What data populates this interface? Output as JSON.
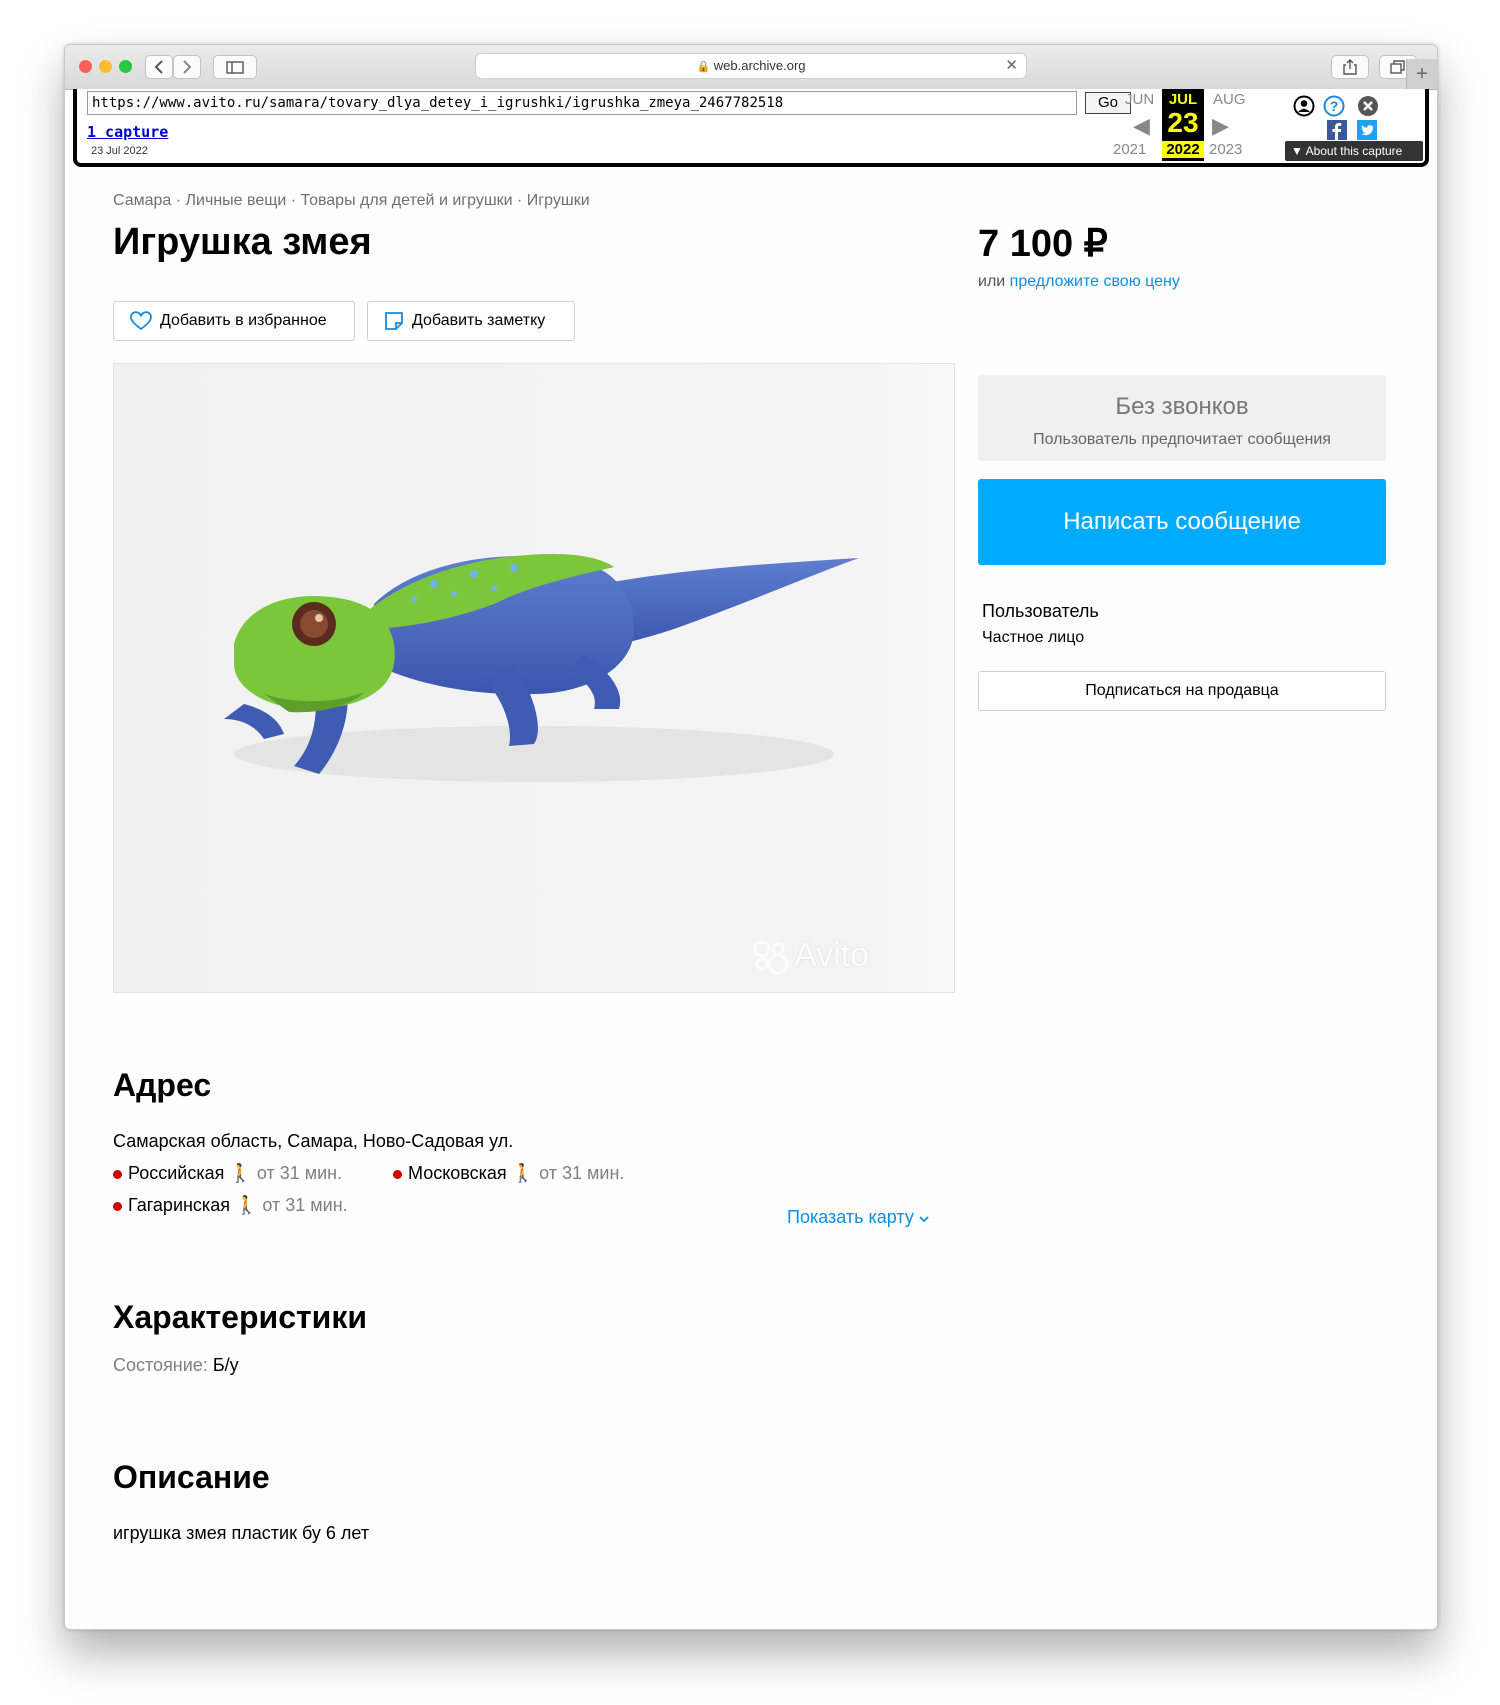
{
  "browser": {
    "address": "web.archive.org"
  },
  "wayback": {
    "url": "https://www.avito.ru/samara/tovary_dlya_detey_i_igrushki/igrushka_zmeya_2467782518",
    "go_label": "Go",
    "captures_link": "1 capture",
    "capture_date": "23 Jul 2022",
    "prev_month": "JUN",
    "cur_month": "JUL",
    "next_month": "AUG",
    "cur_day": "23",
    "prev_year": "2021",
    "cur_year": "2022",
    "next_year": "2023",
    "about_label": "About this capture"
  },
  "listing": {
    "breadcrumbs": "Самара · Личные вещи · Товары для детей и игрушки · Игрушки",
    "title": "Игрушка змея",
    "price": "7 100 ₽",
    "offer_prefix": "или ",
    "offer_link": "предложите свою цену",
    "favorite_label": "Добавить в избранное",
    "note_label": "Добавить заметку",
    "watermark": "Avito"
  },
  "contact": {
    "no_calls_title": "Без звонков",
    "no_calls_sub": "Пользователь предпочитает сообщения",
    "message_button": "Написать сообщение",
    "seller_name": "Пользователь",
    "seller_type": "Частное лицо",
    "subscribe_button": "Подписаться на продавца"
  },
  "address": {
    "heading": "Адрес",
    "text": "Самарская область, Самара, Ново-Садовая ул.",
    "stations": [
      {
        "name": "Российская",
        "time": "от 31 мин."
      },
      {
        "name": "Московская",
        "time": "от 31 мин."
      },
      {
        "name": "Гагаринская",
        "time": "от 31 мин."
      }
    ],
    "show_map": "Показать карту"
  },
  "specs": {
    "heading": "Характеристики",
    "condition_label": "Состояние: ",
    "condition_value": "Б/у"
  },
  "description": {
    "heading": "Описание",
    "text": "игрушка змея пластик бу 6 лет"
  },
  "colors": {
    "accent": "#00aaff",
    "link": "#0a8fe6",
    "metro_red": "#cc0000",
    "wayback_yellow": "#ffff00"
  }
}
